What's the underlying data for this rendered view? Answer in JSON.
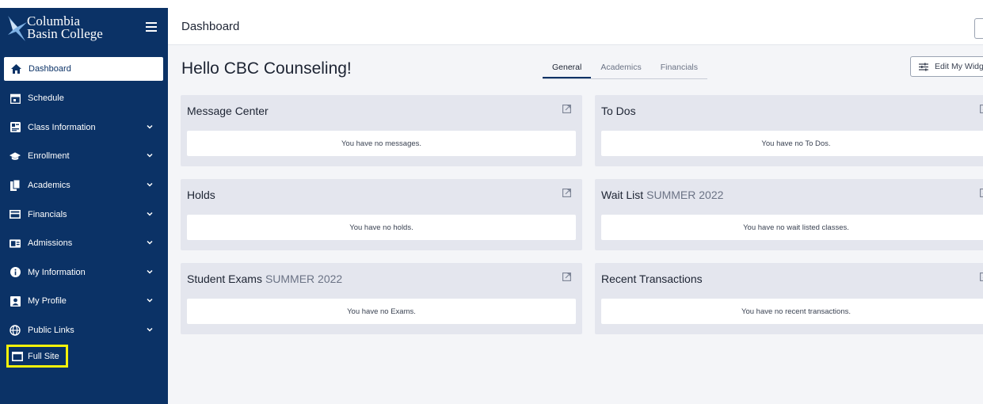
{
  "brand": {
    "line1": "Columbia",
    "line2": "Basin College"
  },
  "header": {
    "title": "Dashboard"
  },
  "nav": [
    {
      "label": "Dashboard",
      "icon": "home-icon",
      "active": true,
      "expandable": false
    },
    {
      "label": "Schedule",
      "icon": "calendar-icon",
      "expandable": false
    },
    {
      "label": "Class Information",
      "icon": "class-info-icon",
      "expandable": true
    },
    {
      "label": "Enrollment",
      "icon": "graduation-cap-icon",
      "expandable": true
    },
    {
      "label": "Academics",
      "icon": "documents-icon",
      "expandable": true
    },
    {
      "label": "Financials",
      "icon": "credit-card-icon",
      "expandable": true
    },
    {
      "label": "Admissions",
      "icon": "id-card-icon",
      "expandable": true
    },
    {
      "label": "My Information",
      "icon": "info-icon",
      "expandable": true
    },
    {
      "label": "My Profile",
      "icon": "profile-icon",
      "expandable": true
    },
    {
      "label": "Public Links",
      "icon": "globe-icon",
      "expandable": true
    }
  ],
  "fullsite": {
    "label": "Full Site",
    "icon": "window-icon"
  },
  "greeting": "Hello CBC Counseling!",
  "tabs": [
    {
      "label": "General",
      "active": true
    },
    {
      "label": "Academics",
      "active": false
    },
    {
      "label": "Financials",
      "active": false
    }
  ],
  "edit_widgets": {
    "label": "Edit My Widgets"
  },
  "cards": {
    "message_center": {
      "title": "Message Center",
      "term": "",
      "body": "You have no messages."
    },
    "todos": {
      "title": "To Dos",
      "term": "",
      "body": "You have no To Dos."
    },
    "holds": {
      "title": "Holds",
      "term": "",
      "body": "You have no holds."
    },
    "waitlist": {
      "title": "Wait List",
      "term": "SUMMER 2022",
      "body": "You have no wait listed classes."
    },
    "exams": {
      "title": "Student Exams",
      "term": "SUMMER 2022",
      "body": "You have no Exams."
    },
    "transactions": {
      "title": "Recent Transactions",
      "term": "",
      "body": "You have no recent transactions."
    }
  },
  "colors": {
    "sidebar": "#0b3266",
    "highlight": "#f5f20a",
    "card": "#e4e6ee",
    "background": "#f4f5f8"
  }
}
